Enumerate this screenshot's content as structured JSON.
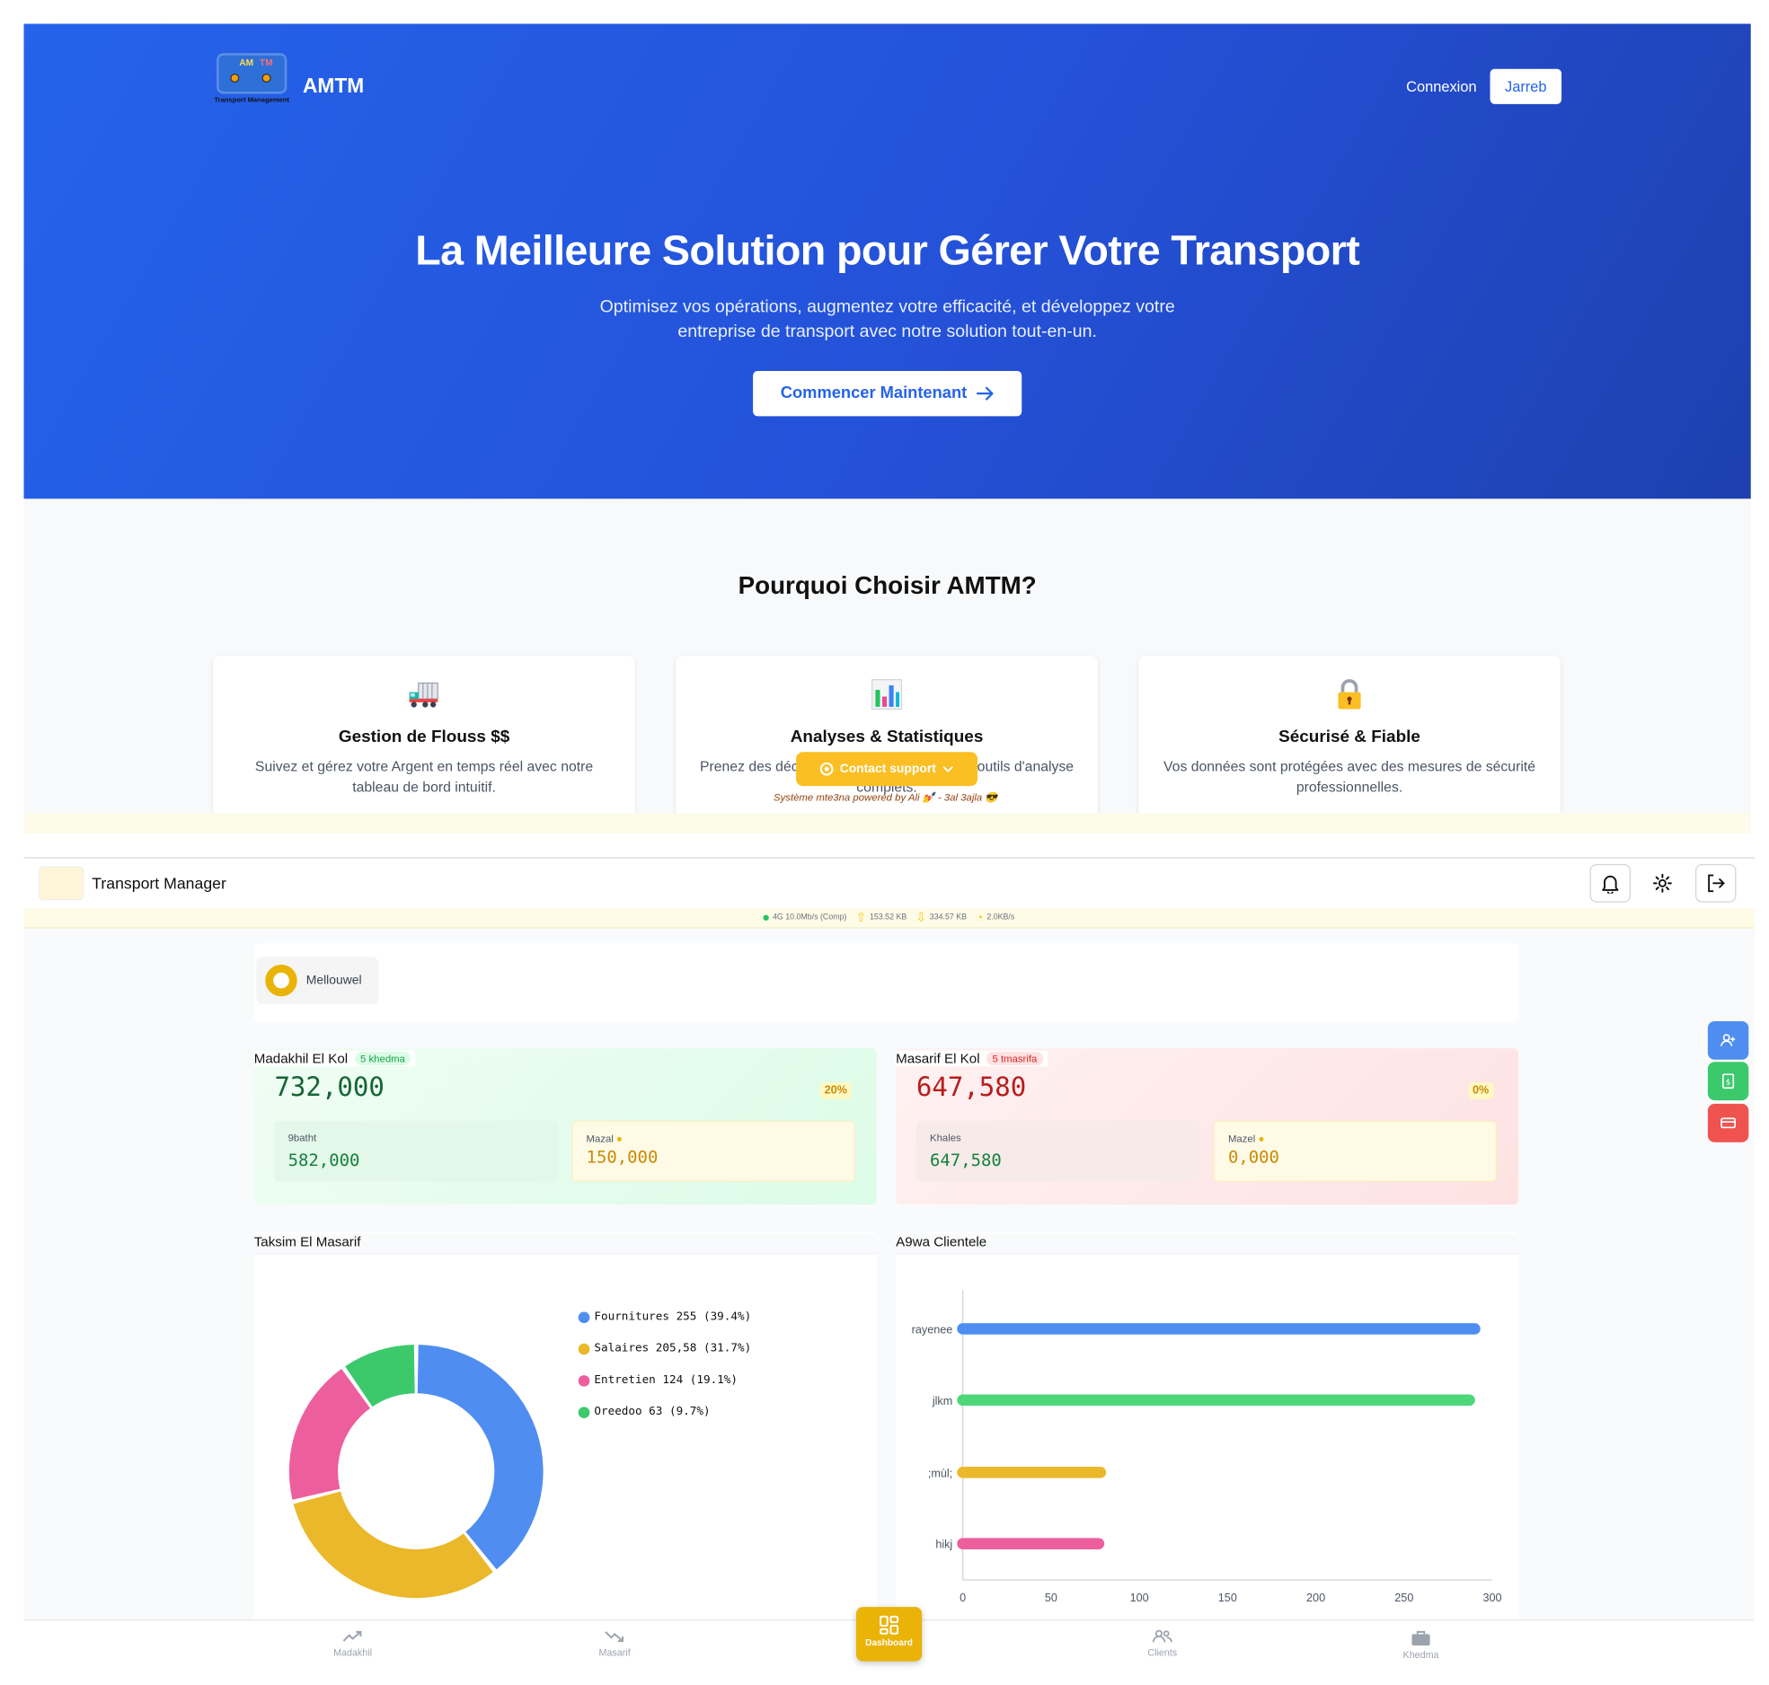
{
  "landing": {
    "logo": {
      "am": "AM",
      "tm": "TM",
      "sub": "Transport Management"
    },
    "brand": "AMTM",
    "nav": {
      "login": "Connexion",
      "try": "Jarreb"
    },
    "hero": {
      "title": "La Meilleure Solution pour Gérer Votre Transport",
      "subtitle": "Optimisez vos opérations, augmentez votre efficacité, et développez votre entreprise de transport avec notre solution tout-en-un.",
      "cta": "Commencer Maintenant"
    },
    "why_title": "Pourquoi Choisir AMTM?",
    "features": [
      {
        "icon": "truck-icon",
        "title": "Gestion de Flouss $$",
        "text": "Suivez et gérez votre Argent en temps réel avec notre tableau de bord intuitif."
      },
      {
        "icon": "bar-chart-icon",
        "title": "Analyses & Statistiques",
        "text": "Prenez des décisions éclairées grâce à nos outils d'analyse complets."
      },
      {
        "icon": "lock-icon",
        "title": "Sécurisé & Fiable",
        "text": "Vos données sont protégées avec des mesures de sécurité professionnelles."
      }
    ],
    "support_button": "Contact support",
    "powered": "Système mte3na powered by Ali 💅 - 3al 3ajla 😎"
  },
  "dashboard": {
    "title": "Transport Manager",
    "network": {
      "conn": "4G 10.0Mb/s (Comp)",
      "up": "153.52 KB",
      "down": "334.57 KB",
      "speed": "2.0KB/s"
    },
    "status_label": "Mellouwel",
    "income": {
      "title": "Madakhil El Kol",
      "badge": "5 khedma",
      "total": "732,000",
      "pct": "20%",
      "paid_label": "9batht",
      "paid": "582,000",
      "due_label": "Mazal",
      "due": "150,000"
    },
    "expenses": {
      "title": "Masarif El Kol",
      "badge": "5 tmasrifa",
      "total": "647,580",
      "pct": "0%",
      "paid_label": "Khales",
      "paid": "647,580",
      "due_label": "Mazel",
      "due": "0,000"
    },
    "donut_title": "Taksim El Masarif",
    "bar_title": "A9wa Clientele",
    "nav": {
      "income": "Madakhil",
      "expenses": "Masarif",
      "dashboard": "Dashboard",
      "clients": "Clients",
      "jobs": "Khedma"
    },
    "colors": {
      "blue": "#4f8ef0",
      "yellow": "#eab82a",
      "pink": "#ec5f9c",
      "green": "#3cc96c"
    }
  },
  "chart_data": [
    {
      "type": "pie",
      "title": "Taksim El Masarif",
      "categories": [
        "Fournitures",
        "Salaires",
        "Entretien",
        "Oreedoo"
      ],
      "values": [
        255,
        205.58,
        124,
        63
      ],
      "labels": [
        "Fournitures 255 (39.4%)",
        "Salaires 205,58 (31.7%)",
        "Entretien 124 (19.1%)",
        "Oreedoo 63 (9.7%)"
      ],
      "colors": [
        "#4f8ef0",
        "#eab82a",
        "#ec5f9c",
        "#3cc96c"
      ]
    },
    {
      "type": "bar",
      "orientation": "horizontal",
      "title": "A9wa Clientele",
      "categories": [
        "rayenee",
        "jlkm",
        ";mùl;",
        "hikj"
      ],
      "values": [
        290,
        287,
        78,
        77
      ],
      "colors": [
        "#4f8ef0",
        "#4ed67a",
        "#eab82a",
        "#ec5f9c"
      ],
      "xlim": [
        0,
        300
      ],
      "xticks": [
        "0",
        "50",
        "100",
        "150",
        "200",
        "250",
        "300"
      ]
    }
  ]
}
